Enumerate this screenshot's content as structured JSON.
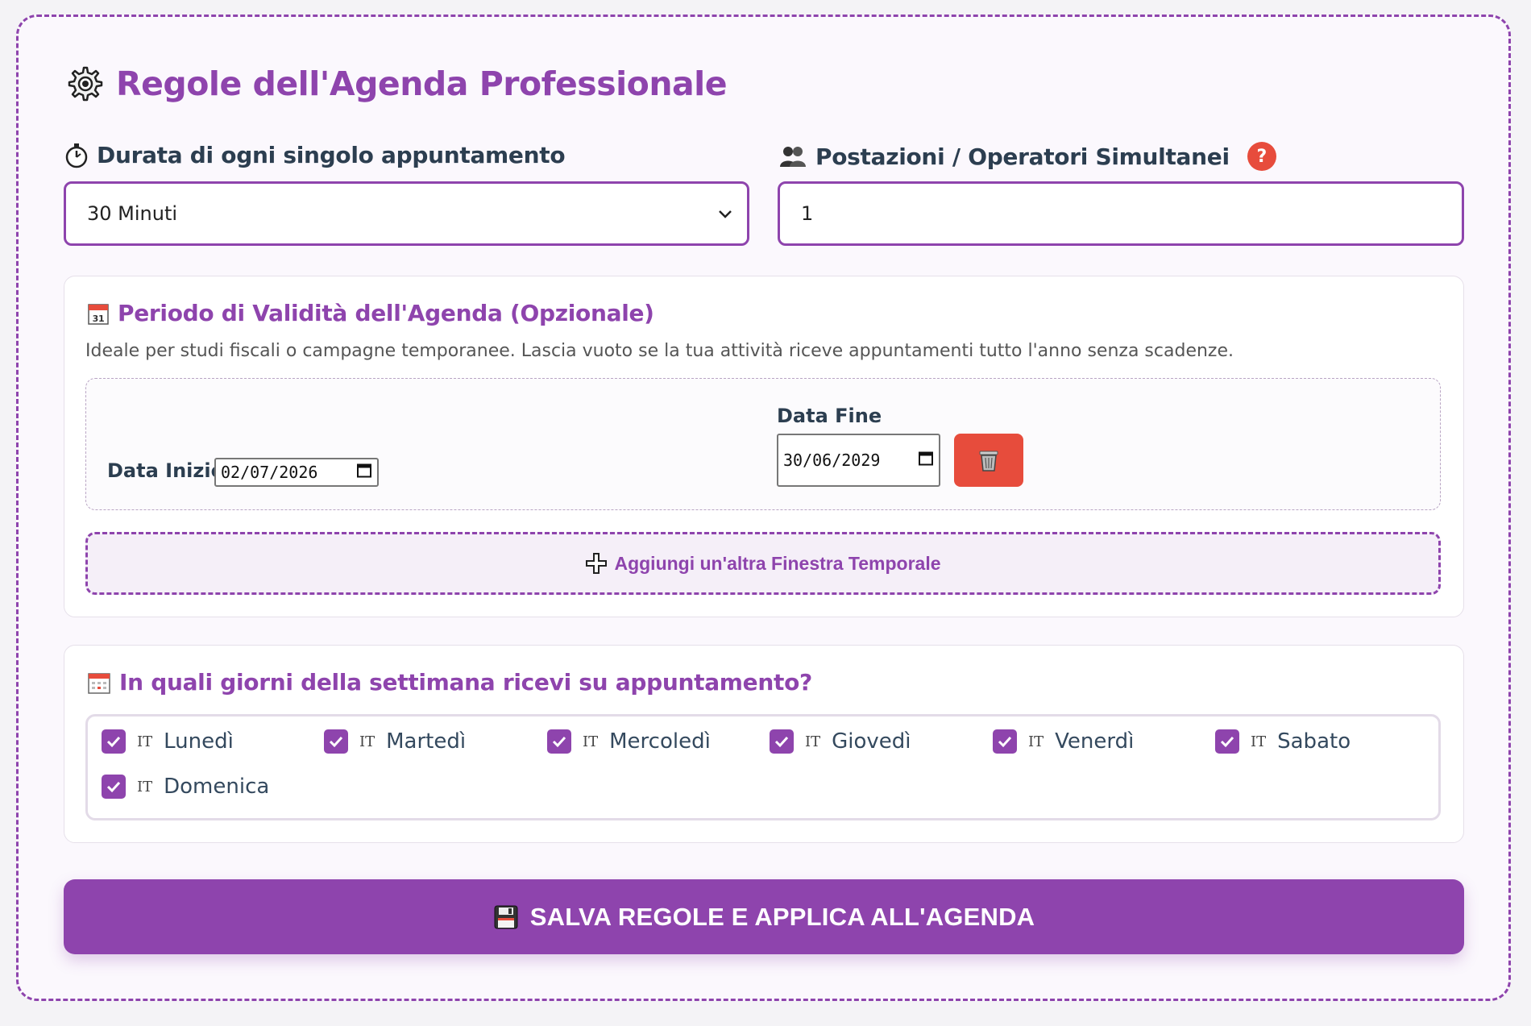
{
  "page": {
    "title": "Regole dell'Agenda Professionale",
    "title_icon": "gear-icon"
  },
  "duration": {
    "label": "Durata di ogni singolo appuntamento",
    "icon": "stopwatch-icon",
    "selected": "30 Minuti"
  },
  "stations": {
    "label": "Postazioni / Operatori Simultanei",
    "icon": "people-icon",
    "help": "?",
    "value": "1"
  },
  "validity": {
    "title": "Periodo di Validità dell'Agenda (Opzionale)",
    "icon": "calendar-icon",
    "description": "Ideale per studi fiscali o campagne temporanee. Lascia vuoto se la tua attività riceve appuntamenti tutto l'anno senza scadenze.",
    "start_label": "Data Inizio",
    "start_value": "02/07/2026",
    "end_label": "Data Fine",
    "end_value": "30/06/2029",
    "add_label": "Aggiungi un'altra Finestra Temporale"
  },
  "days": {
    "title": "In quali giorni della settimana ricevi su appuntamento?",
    "icon": "calendar-icon",
    "flag": "IT",
    "items": [
      {
        "label": "Lunedì",
        "checked": true
      },
      {
        "label": "Martedì",
        "checked": true
      },
      {
        "label": "Mercoledì",
        "checked": true
      },
      {
        "label": "Giovedì",
        "checked": true
      },
      {
        "label": "Venerdì",
        "checked": true
      },
      {
        "label": "Sabato",
        "checked": true
      },
      {
        "label": "Domenica",
        "checked": true
      }
    ]
  },
  "save": {
    "label": "SALVA REGOLE E APPLICA ALL'AGENDA",
    "icon": "floppy-disk-icon"
  },
  "colors": {
    "accent": "#8e44ad",
    "danger": "#e74c3c",
    "heading": "#2c3e50"
  }
}
